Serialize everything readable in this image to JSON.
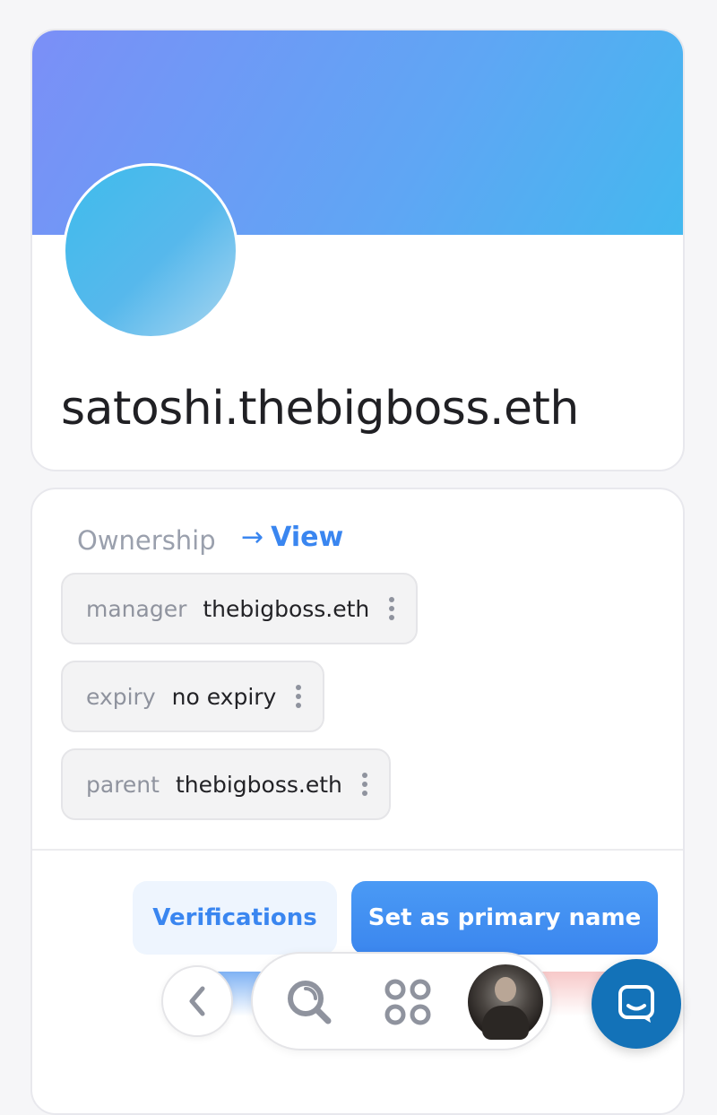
{
  "profile": {
    "name": "satoshi.thebigboss.eth"
  },
  "ownership": {
    "title": "Ownership",
    "view_label": "View",
    "rows": [
      {
        "key": "manager",
        "value": "thebigboss.eth"
      },
      {
        "key": "expiry",
        "value": "no expiry"
      },
      {
        "key": "parent",
        "value": "thebigboss.eth"
      }
    ]
  },
  "actions": {
    "verifications_label": "Verifications",
    "primary_label": "Set as primary name"
  },
  "nav": {
    "icons": [
      "chevron-left-icon",
      "search-icon",
      "apps-icon",
      "user-avatar",
      "chat-icon"
    ]
  },
  "colors": {
    "accent": "#3a86f0",
    "banner_start": "#7b8ff7",
    "banner_end": "#44b8ef",
    "chat_button": "#1372b8"
  }
}
